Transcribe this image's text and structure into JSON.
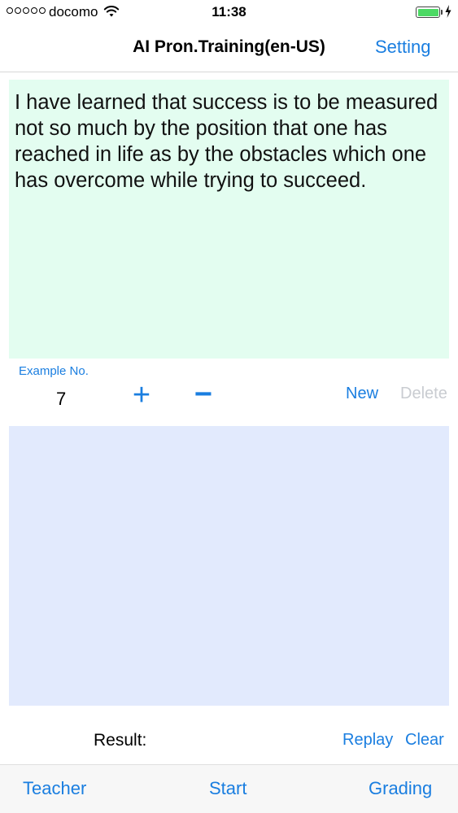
{
  "status_bar": {
    "carrier": "docomo",
    "time": "11:38",
    "battery_level": 1.0,
    "signal_dots": 5,
    "icons": [
      "signal-dots-icon",
      "wifi-icon",
      "battery-icon",
      "charging-bolt-icon"
    ]
  },
  "nav": {
    "title": "AI Pron.Training(en-US)",
    "setting_label": "Setting"
  },
  "example": {
    "text": "I have learned that success is to be measured not so much by the position that one has reached in life as by the obstacles which one has overcome while trying to succeed.",
    "label": "Example No.",
    "number": "7",
    "plus_label": "+",
    "minus_label": "−",
    "new_label": "New",
    "delete_label": "Delete"
  },
  "result": {
    "label": "Result:",
    "replay_label": "Replay",
    "clear_label": "Clear"
  },
  "toolbar": {
    "teacher_label": "Teacher",
    "start_label": "Start",
    "grading_label": "Grading"
  },
  "colors": {
    "accent": "#1a7ee0",
    "disabled": "#c9ccd1",
    "text_panel_bg": "#e3fdf0",
    "result_panel_bg": "#e2eafd",
    "battery_fill": "#4cd964"
  }
}
